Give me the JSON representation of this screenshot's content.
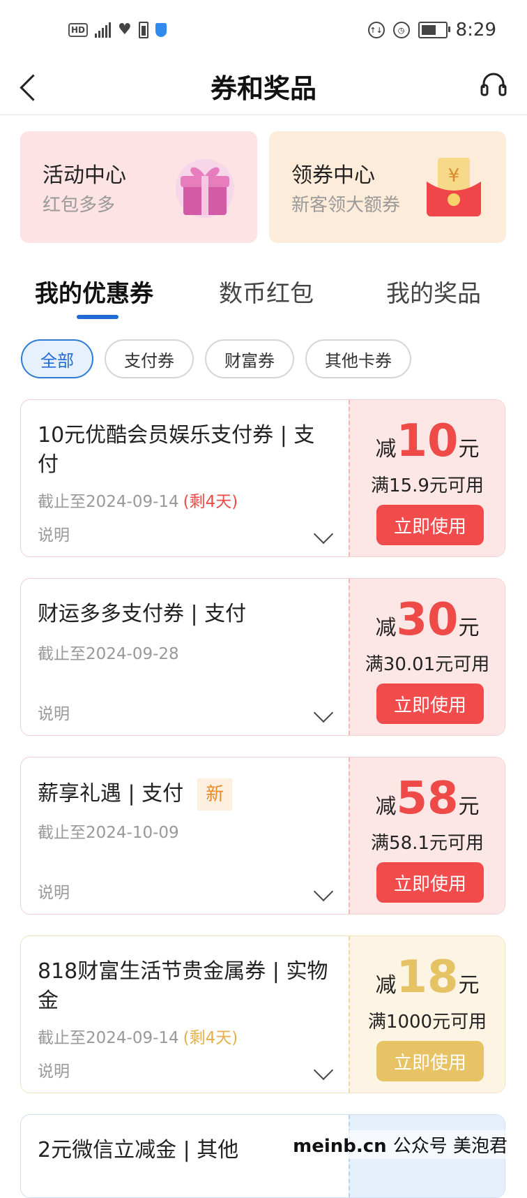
{
  "status_bar": {
    "time": "8:29",
    "left_icons": [
      "hd-icon",
      "5g-signal-icon",
      "health-icon",
      "battery-small-icon",
      "shield-icon"
    ],
    "right_icons": [
      "data-saver-icon",
      "alarm-icon",
      "battery-icon"
    ]
  },
  "nav": {
    "title": "券和奖品",
    "back_icon": "chevron-left-icon",
    "service_icon": "headset-icon"
  },
  "top_cards": [
    {
      "title": "活动中心",
      "subtitle": "红包多多",
      "icon": "gift-box-icon"
    },
    {
      "title": "领券中心",
      "subtitle": "新客领大额券",
      "icon": "red-envelope-icon"
    }
  ],
  "tabs": [
    {
      "label": "我的优惠券",
      "active": true
    },
    {
      "label": "数币红包",
      "active": false
    },
    {
      "label": "我的奖品",
      "active": false
    }
  ],
  "filters": [
    {
      "label": "全部",
      "active": true
    },
    {
      "label": "支付券",
      "active": false
    },
    {
      "label": "财富券",
      "active": false
    },
    {
      "label": "其他卡券",
      "active": false
    }
  ],
  "coupons": [
    {
      "title": "10元优酷会员娱乐支付券 | 支付",
      "expiry": "截止至2024-09-14",
      "remain": "(剩4天)",
      "note": "说明",
      "prefix": "减",
      "value": "10",
      "unit": "元",
      "condition": "满15.9元可用",
      "button": "立即使用",
      "theme": "red"
    },
    {
      "title": "财运多多支付券 | 支付",
      "expiry": "截止至2024-09-28",
      "remain": "",
      "note": "说明",
      "prefix": "减",
      "value": "30",
      "unit": "元",
      "condition": "满30.01元可用",
      "button": "立即使用",
      "theme": "red"
    },
    {
      "title": "薪享礼遇 | 支付",
      "tag": "新",
      "expiry": "截止至2024-10-09",
      "remain": "",
      "note": "说明",
      "prefix": "减",
      "value": "58",
      "unit": "元",
      "condition": "满58.1元可用",
      "button": "立即使用",
      "theme": "red"
    },
    {
      "title": "818财富生活节贵金属券 | 实物金",
      "expiry": "截止至2024-09-14",
      "remain": "(剩4天)",
      "note": "说明",
      "prefix": "减",
      "value": "18",
      "unit": "元",
      "condition": "满1000元可用",
      "button": "立即使用",
      "theme": "gold"
    },
    {
      "title": "2元微信立减金 | 其他",
      "theme": "blue"
    }
  ],
  "watermark": {
    "site": "meinb.cn",
    "text": "公众号 美泡君"
  },
  "colors": {
    "accent_blue": "#1f6ad6",
    "coupon_red": "#ee4a47",
    "coupon_gold": "#e5c264"
  }
}
